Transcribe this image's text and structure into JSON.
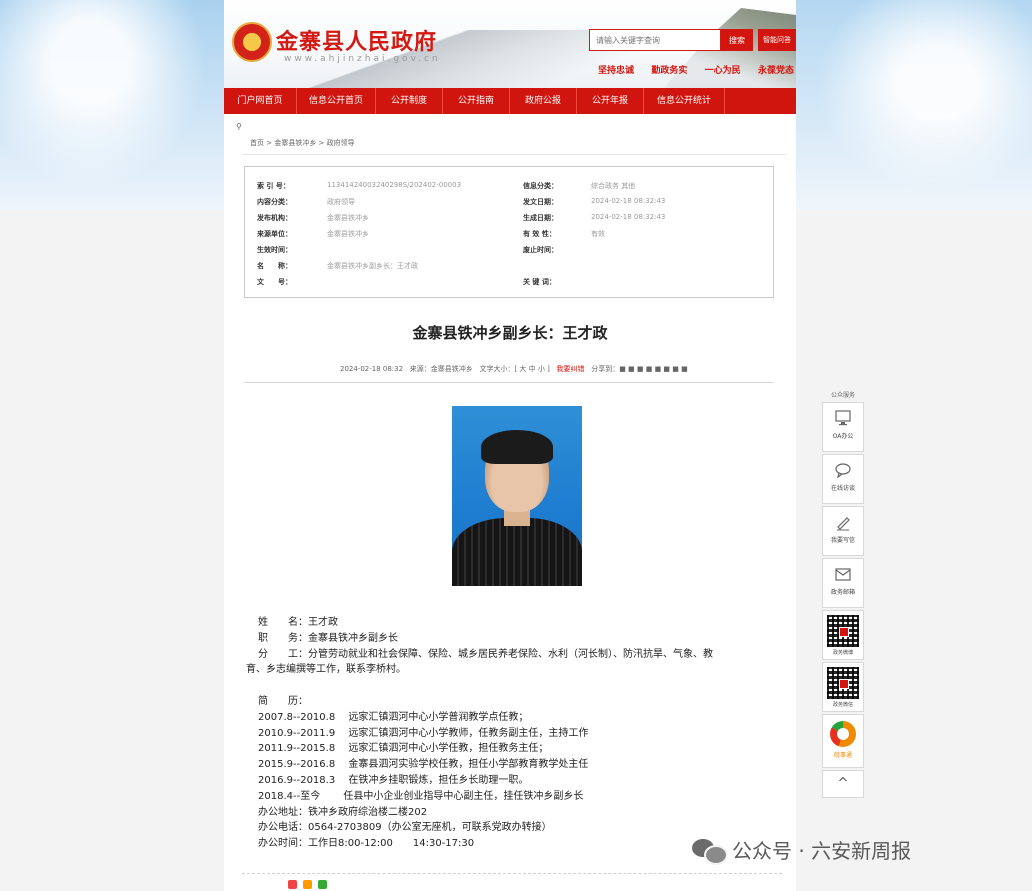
{
  "header": {
    "site_title": "金寨县人民政府",
    "site_url": "www.ahjinzhai.gov.cn",
    "search_placeholder": "请输入关键字查询",
    "search_button": "搜索",
    "advanced_button": "智能问答",
    "slogans": [
      "坚持忠诚",
      "勤政务实",
      "一心为民",
      "永葆党态"
    ]
  },
  "nav": {
    "items": [
      "门户网首页",
      "信息公开首页",
      "公开制度",
      "公开指南",
      "政府公报",
      "公开年报",
      "信息公开统计"
    ]
  },
  "breadcrumb": {
    "location_label": "当前位置：",
    "path": "首页 > 金寨县铁冲乡 > 政府领导"
  },
  "info": {
    "index_no_label": "索 引 号：",
    "index_no": "11341424003240298S/202402-00003",
    "category_label": "信息分类：",
    "category": "综合政务 其他",
    "topic_label": "内容分类：",
    "topic": "政府领导",
    "gen_date_label": "发文日期：",
    "gen_date": "2024-02-18 08:32:43",
    "publisher_label": "发布机构：",
    "publisher": "金寨县铁冲乡",
    "pub_date_label": "生成日期：",
    "pub_date": "2024-02-18 08:32:43",
    "source_label": "来源单位：",
    "source": "金寨县铁冲乡",
    "valid_label": "有 效 性：",
    "valid": "有效",
    "start_label": "生效时间：",
    "start": "",
    "end_label": "废止时间：",
    "end": "",
    "name_label": "名　　称：",
    "name": "金寨县铁冲乡副乡长：王才政",
    "doc_no_label": "文　　号：",
    "doc_no": "",
    "keywords_label": "关 键 词：",
    "keywords": ""
  },
  "article": {
    "title": "金寨县铁冲乡副乡长：王才政",
    "date": "2024-02-18 08:32",
    "source": "来源：金寨县铁冲乡",
    "font_size": "文字大小：[ 大 中 小 ]",
    "print": "我要纠错",
    "share": "分享到：",
    "lines": [
      "姓　　名：王才政",
      "职　　务：金寨县铁冲乡副乡长",
      "分　　工：分管劳动就业和社会保障、保险、城乡居民养老保险、水利（河长制）、防汛抗旱、气象、教",
      "育、乡志编撰等工作，联系李桥村。",
      "",
      "简　　历：",
      "2007.8--2010.8　 远家汇镇泗河中心小学普润教学点任教；",
      "2010.9--2011.9　 远家汇镇泗河中心小学教师，任教务副主任，主持工作",
      "2011.9--2015.8　 远家汇镇泗河中心小学任教，担任教务主任；",
      "2015.9--2016.8　 金寨县泗河实验学校任教，担任小学部教育教学处主任",
      "2016.9--2018.3　 在铁冲乡挂职锻炼，担任乡长助理一职。",
      "2018.4--至今　　 任县中小企业创业指导中心副主任，挂任铁冲乡副乡长",
      "办公地址：铁冲乡政府综治楼二楼202",
      "办公电话：0564-2703809（办公室无座机，可联系党政办转接）",
      "办公时间：工作日8:00-12:00　　14:30-17:30"
    ]
  },
  "sidebar": {
    "header": "公众服务",
    "items": [
      "OA办公",
      "在线访谈",
      "我要写信",
      "政务邮箱"
    ],
    "qr_labels": [
      "政务微博",
      "政务微信"
    ],
    "app_label": "皖事通",
    "top_label": "^"
  },
  "watermark": {
    "text": "公众号 · 六安新周报"
  },
  "colors": {
    "brand_red": "#d0150e",
    "link_red": "#d3150f"
  }
}
